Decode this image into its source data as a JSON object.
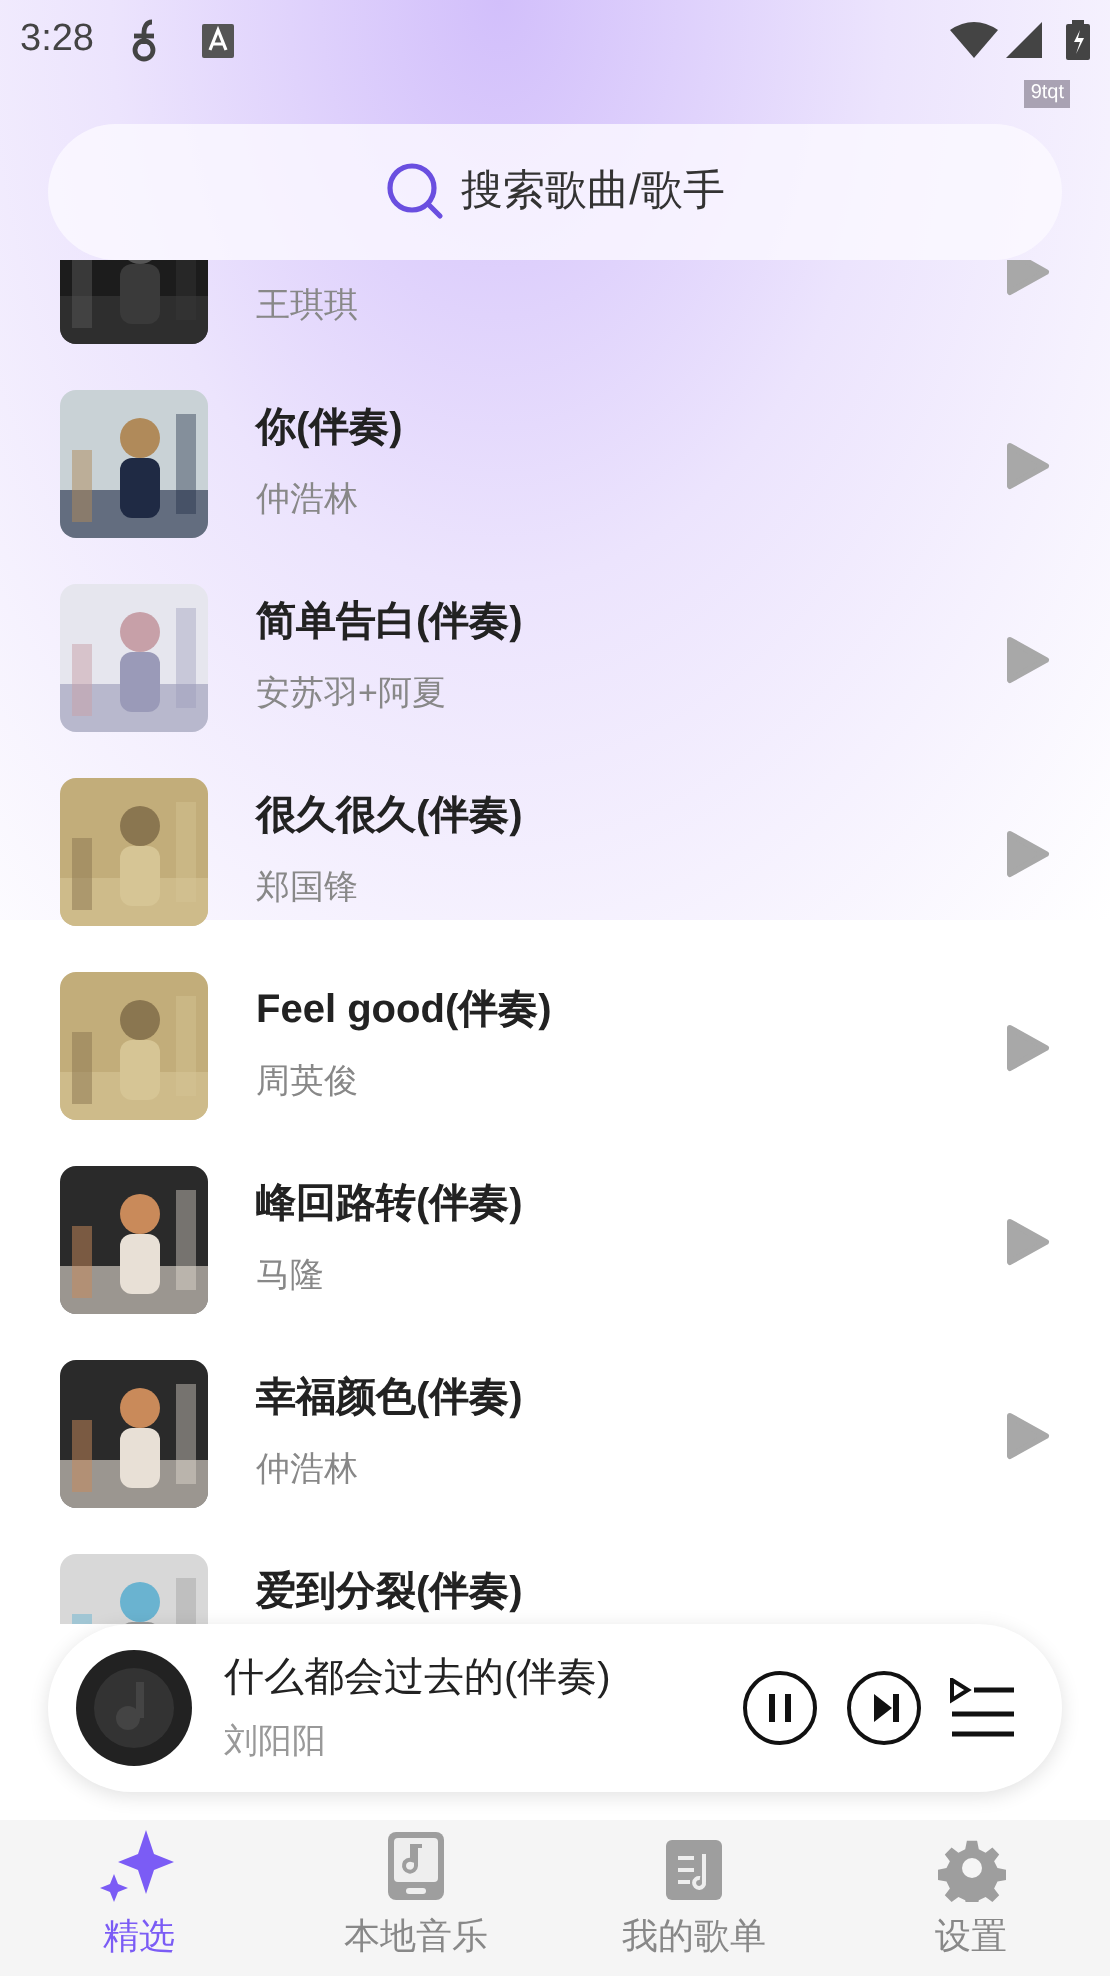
{
  "status_bar": {
    "time": "3:28",
    "tag": "9tqt"
  },
  "search": {
    "placeholder": "搜索歌曲/歌手"
  },
  "songs": [
    {
      "artist": "王琪琪"
    },
    {
      "title": "你(伴奏)",
      "artist": "仲浩林"
    },
    {
      "title": "简单告白(伴奏)",
      "artist": "安苏羽+阿夏"
    },
    {
      "title": "很久很久(伴奏)",
      "artist": "郑国锋"
    },
    {
      "title": "Feel good(伴奏)",
      "artist": "周英俊"
    },
    {
      "title": "峰回路转(伴奏)",
      "artist": "马隆"
    },
    {
      "title": "幸福颜色(伴奏)",
      "artist": "仲浩林"
    },
    {
      "title": "爱到分裂(伴奏)"
    }
  ],
  "player": {
    "title": "什么都会过去的(伴奏)",
    "artist": "刘阳阳",
    "playing": true
  },
  "tabs": [
    {
      "label": "精选",
      "selected": true
    },
    {
      "label": "本地音乐",
      "selected": false
    },
    {
      "label": "我的歌单",
      "selected": false
    },
    {
      "label": "设置",
      "selected": false
    }
  ]
}
